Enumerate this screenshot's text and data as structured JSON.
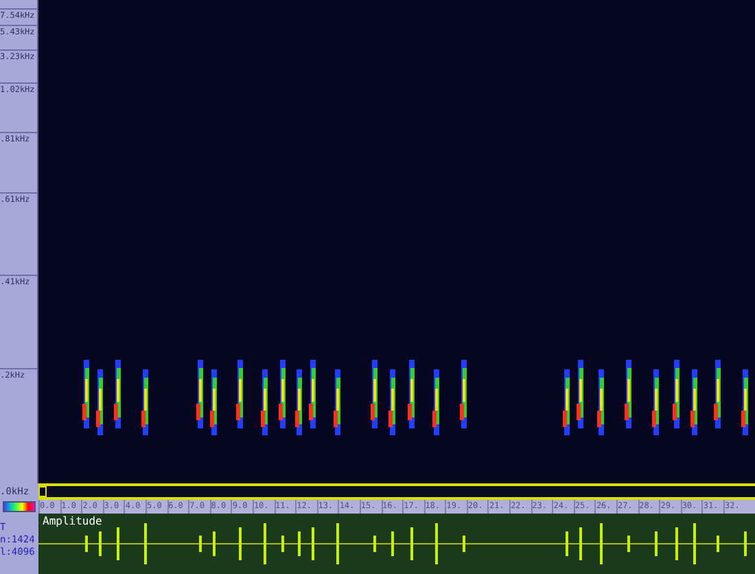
{
  "frequency_axis": {
    "labels": [
      "7.54kHz",
      "5.43kHz",
      "3.23kHz",
      "1.02kHz",
      ".81kHz",
      ".61kHz",
      ".41kHz",
      ".2kHz"
    ],
    "baseline": ".0kHz"
  },
  "time_axis": {
    "labels": [
      "0.0",
      "1.0",
      "2.0",
      "3.0",
      "4.0",
      "5.0",
      "6.0",
      "7.0",
      "8.0",
      "9.0",
      "10.",
      "11.",
      "12.",
      "13.",
      "14.",
      "15.",
      "16.",
      "17.",
      "18.",
      "19.",
      "20.",
      "21.",
      "22.",
      "23.",
      "24.",
      "25.",
      "26.",
      "27.",
      "28.",
      "29.",
      "30.",
      "31.",
      "32."
    ]
  },
  "amplitude_panel": {
    "title": "Amplitude"
  },
  "fft_info": {
    "title": "T",
    "lines": [
      "n:1424",
      "l:4096"
    ]
  }
}
